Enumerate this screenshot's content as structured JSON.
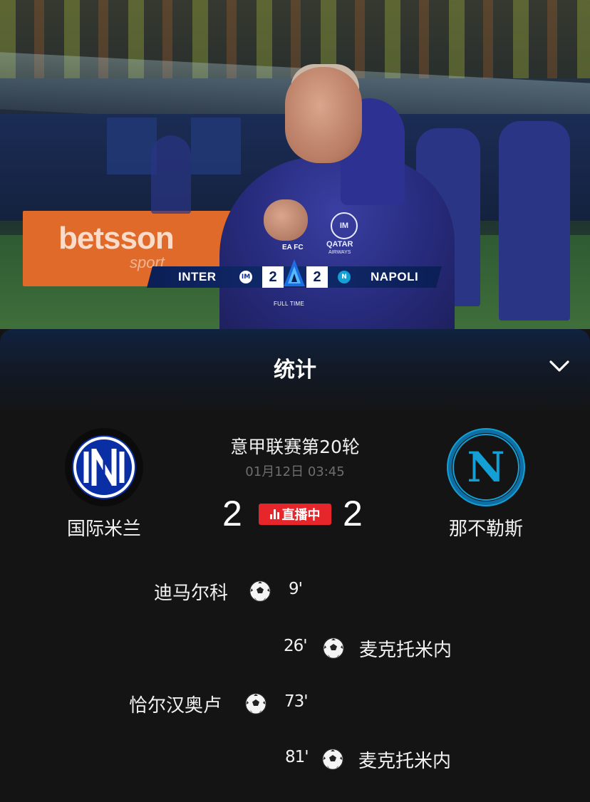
{
  "video": {
    "scoreboard": {
      "home_team": "INTER",
      "home_score": "2",
      "away_score": "2",
      "away_team": "NAPOLI",
      "status": "FULL TIME"
    },
    "ad_brand": "betsson",
    "ad_sub": "sport",
    "sponsor": "QATAR",
    "sponsor_sub": "AIRWAYS",
    "kit_logo": "EA FC"
  },
  "panel": {
    "title": "统计",
    "collapse_icon": "chevron-down-icon",
    "match": {
      "competition": "意甲联赛第20轮",
      "datetime": "01月12日 03:45",
      "live_label": "直播中",
      "home": {
        "name": "国际米兰",
        "score": "2",
        "color": "#0a2ea3"
      },
      "away": {
        "name": "那不勒斯",
        "score": "2",
        "color": "#12a0d7"
      }
    },
    "events": [
      {
        "side": "home",
        "player": "迪马尔科",
        "minute": "9'"
      },
      {
        "side": "away",
        "player": "麦克托米内",
        "minute": "26'"
      },
      {
        "side": "home",
        "player": "恰尔汉奥卢",
        "minute": "73'"
      },
      {
        "side": "away",
        "player": "麦克托米内",
        "minute": "81'"
      }
    ]
  },
  "colors": {
    "background": "#141414",
    "live_red": "#e6262b",
    "inter_blue": "#0a2ea3",
    "napoli_blue": "#12a0d7"
  }
}
